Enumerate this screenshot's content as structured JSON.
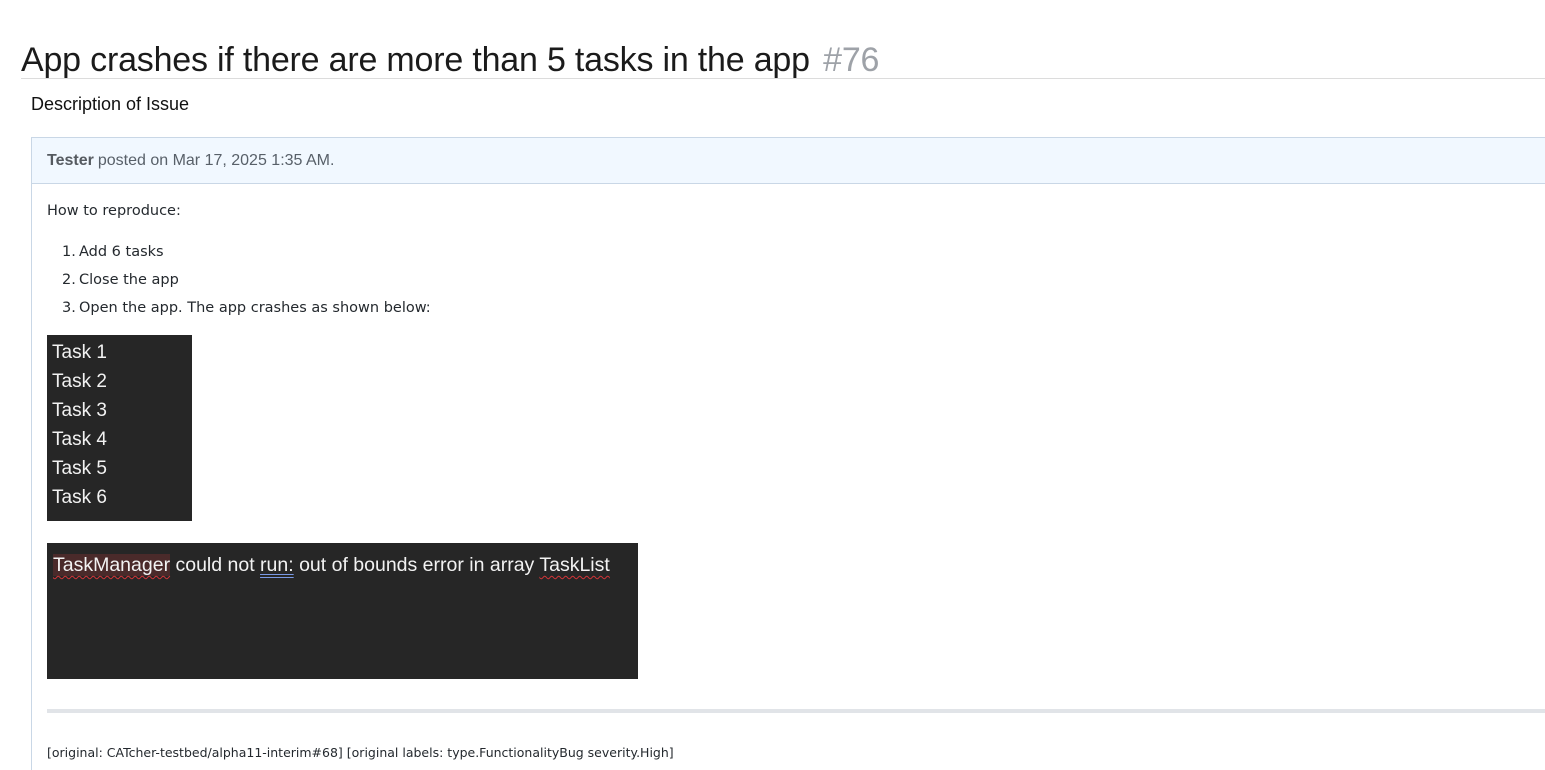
{
  "issue": {
    "title": "App crashes if there are more than 5 tasks in the app",
    "number": "#76"
  },
  "section_heading": "Description of Issue",
  "comment": {
    "author": "Tester",
    "posted_text": "posted on Mar 17, 2025 1:35 AM.",
    "intro": "How to reproduce:",
    "steps": [
      {
        "num": "1.",
        "text": "Add 6 tasks"
      },
      {
        "num": "2.",
        "text": "Close the app"
      },
      {
        "num": "3.",
        "text": "Open the app. The app crashes as shown below:"
      }
    ],
    "task_screenshot": {
      "lines": [
        "Task 1",
        "Task 2",
        "Task 3",
        "Task 4",
        "Task 5",
        "Task 6"
      ],
      "background": "#262626"
    },
    "error_screenshot": {
      "word1": "TaskManager",
      "text1": " could not ",
      "word2": "run:",
      "text2": " out of bounds error in array ",
      "word3": "TaskList",
      "background": "#262626"
    },
    "footer": "[original: CATcher-testbed/alpha11-interim#68] [original labels: type.FunctionalityBug severity.High]"
  },
  "colors": {
    "header_bg": "#f1f8ff",
    "card_border": "#c9d7e6",
    "issue_number": "#9ea2a8"
  }
}
